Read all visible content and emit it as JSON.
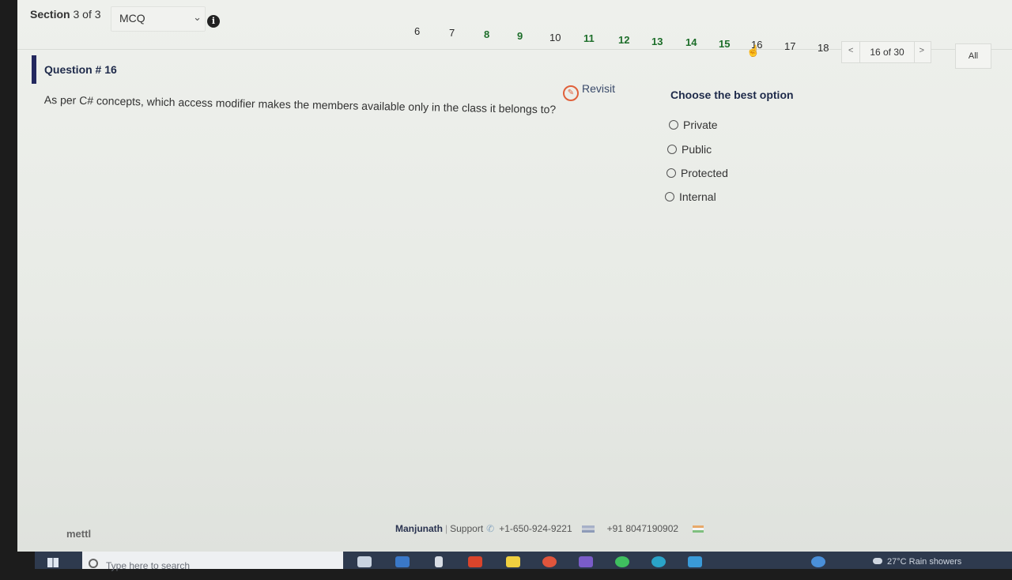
{
  "header": {
    "section_prefix": "Section",
    "section_current": "3",
    "section_of": "of 3",
    "section_type": "MCQ",
    "info_icon": "info-icon"
  },
  "question_nav": {
    "numbers": [
      "6",
      "7",
      "8",
      "9",
      "10",
      "11",
      "12",
      "13",
      "14",
      "15",
      "16",
      "17",
      "18"
    ],
    "answered": [
      "8",
      "9",
      "11",
      "12",
      "13",
      "14",
      "15"
    ],
    "current": "16",
    "answered_color": "#1d6e2a",
    "pager": {
      "prev": "<",
      "count": "16 of 30",
      "next": ">"
    },
    "all_label": "All"
  },
  "question": {
    "title": "Question # 16",
    "revisit_label": "Revisit",
    "text": "As per C# concepts, which access modifier makes the members available only in the class it belongs to?"
  },
  "options": {
    "heading": "Choose the best option",
    "items": [
      "Private",
      "Public",
      "Protected",
      "Internal"
    ]
  },
  "footer": {
    "brand": "mettl",
    "contact_name": "Manjunath",
    "support_label": "Support",
    "phone_us": "+1-650-924-9221",
    "phone_in": "+91 8047190902"
  },
  "taskbar": {
    "search_placeholder": "Type here to search",
    "weather": "27°C  Rain showers"
  },
  "colors": {
    "accent_bar": "#23285e",
    "revisit_icon": "#e0603a",
    "taskbar": "#2e3a4e"
  }
}
